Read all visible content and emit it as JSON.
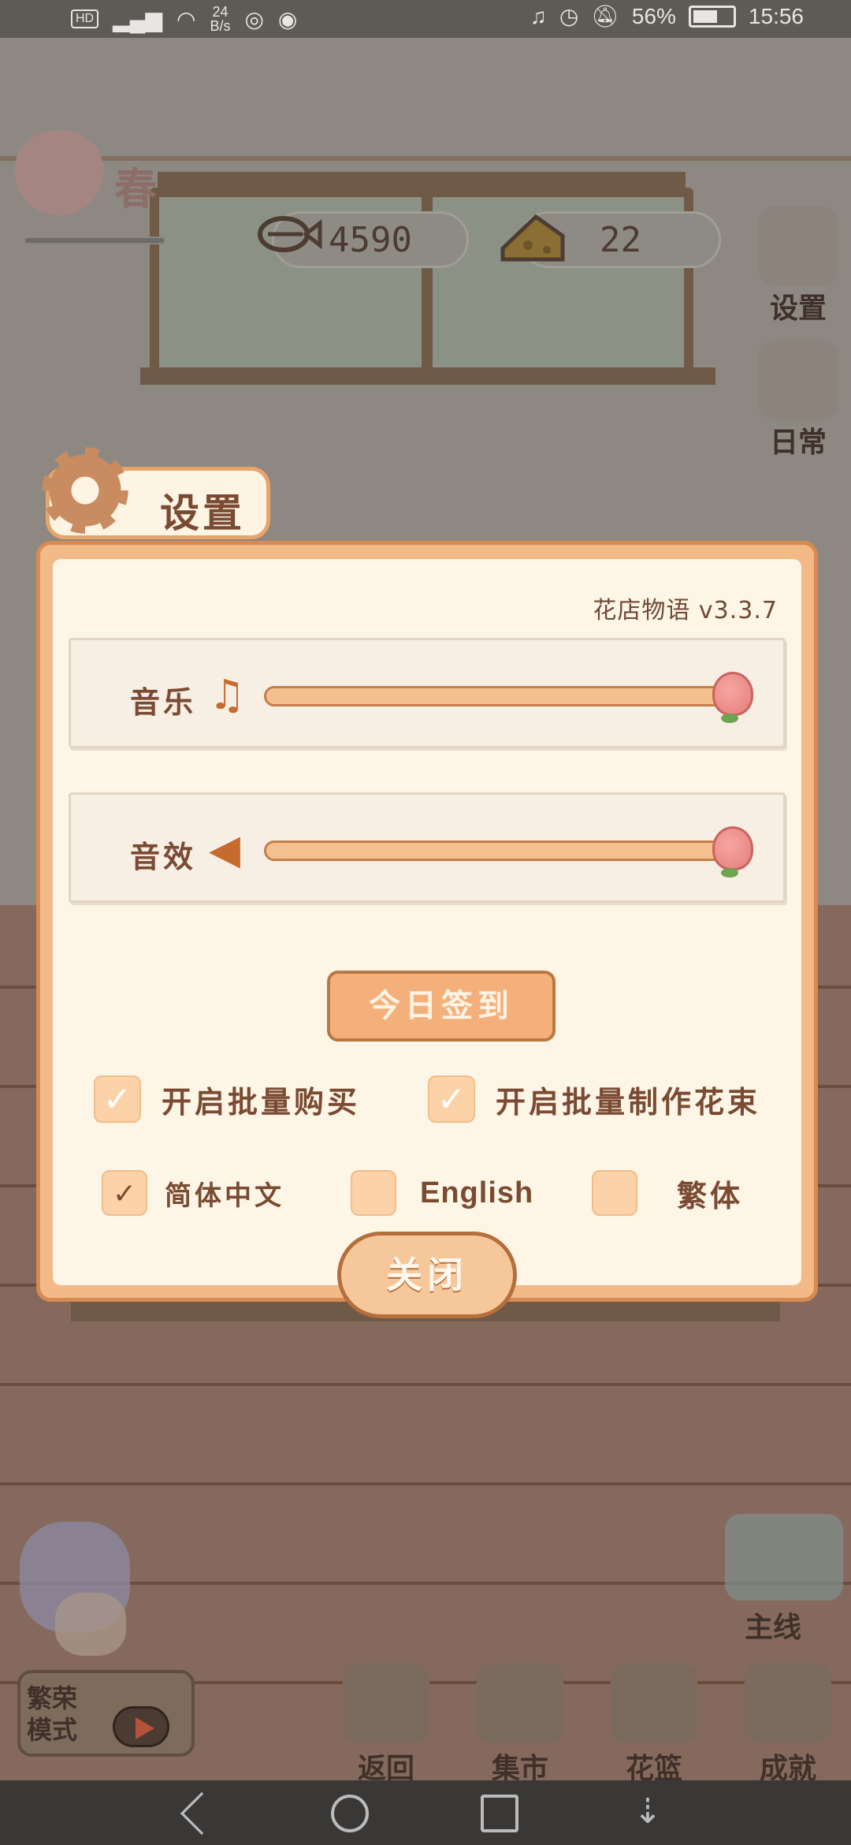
{
  "status_bar": {
    "hd": "HD",
    "net_rate": "24\nB/s",
    "battery": "56%",
    "time": "15:56"
  },
  "hud": {
    "season": "春",
    "fish_count": "4590",
    "cheese_count": "22",
    "side_buttons": [
      "设置",
      "日常"
    ],
    "mainline": "主线",
    "prosper_mode": "繁荣模式",
    "bottom_buttons": [
      "返回",
      "集市",
      "花篮",
      "成就"
    ]
  },
  "dialog": {
    "title": "设置",
    "version": "花店物语 v3.3.7",
    "music_label": "音乐",
    "sfx_label": "音效",
    "music_level": 1.0,
    "sfx_level": 1.0,
    "signin_label": "今日签到",
    "options": [
      {
        "label": "开启批量购买",
        "checked": true
      },
      {
        "label": "开启批量制作花束",
        "checked": true
      }
    ],
    "languages": [
      {
        "label": "简体中文",
        "checked": true
      },
      {
        "label": "English",
        "checked": false
      },
      {
        "label": "繁体",
        "checked": false
      }
    ],
    "close_label": "关闭"
  },
  "colors": {
    "dialog_fill": "#fdf5e6",
    "dialog_border": "#d78a52",
    "accent": "#f4b07b",
    "text": "#7a4b32"
  }
}
